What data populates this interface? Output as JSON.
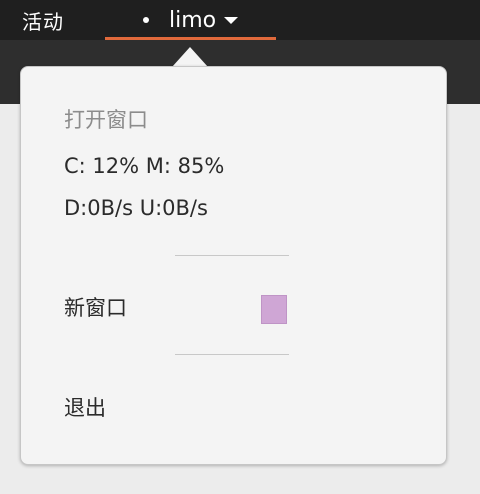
{
  "topbar": {
    "activities_label": "活动",
    "app_name": "limo"
  },
  "menu": {
    "heading": "打开窗口",
    "stats": {
      "cpu_mem": "C: 12%  M: 85%",
      "network": "D:0B/s U:0B/s"
    },
    "new_window_label": "新窗口",
    "new_window_color": "#cfa6d5",
    "quit_label": "退出"
  },
  "colors": {
    "topbar_bg": "#1f1f1f",
    "accent_underline": "#e0693b",
    "popover_bg": "#f4f4f4"
  }
}
